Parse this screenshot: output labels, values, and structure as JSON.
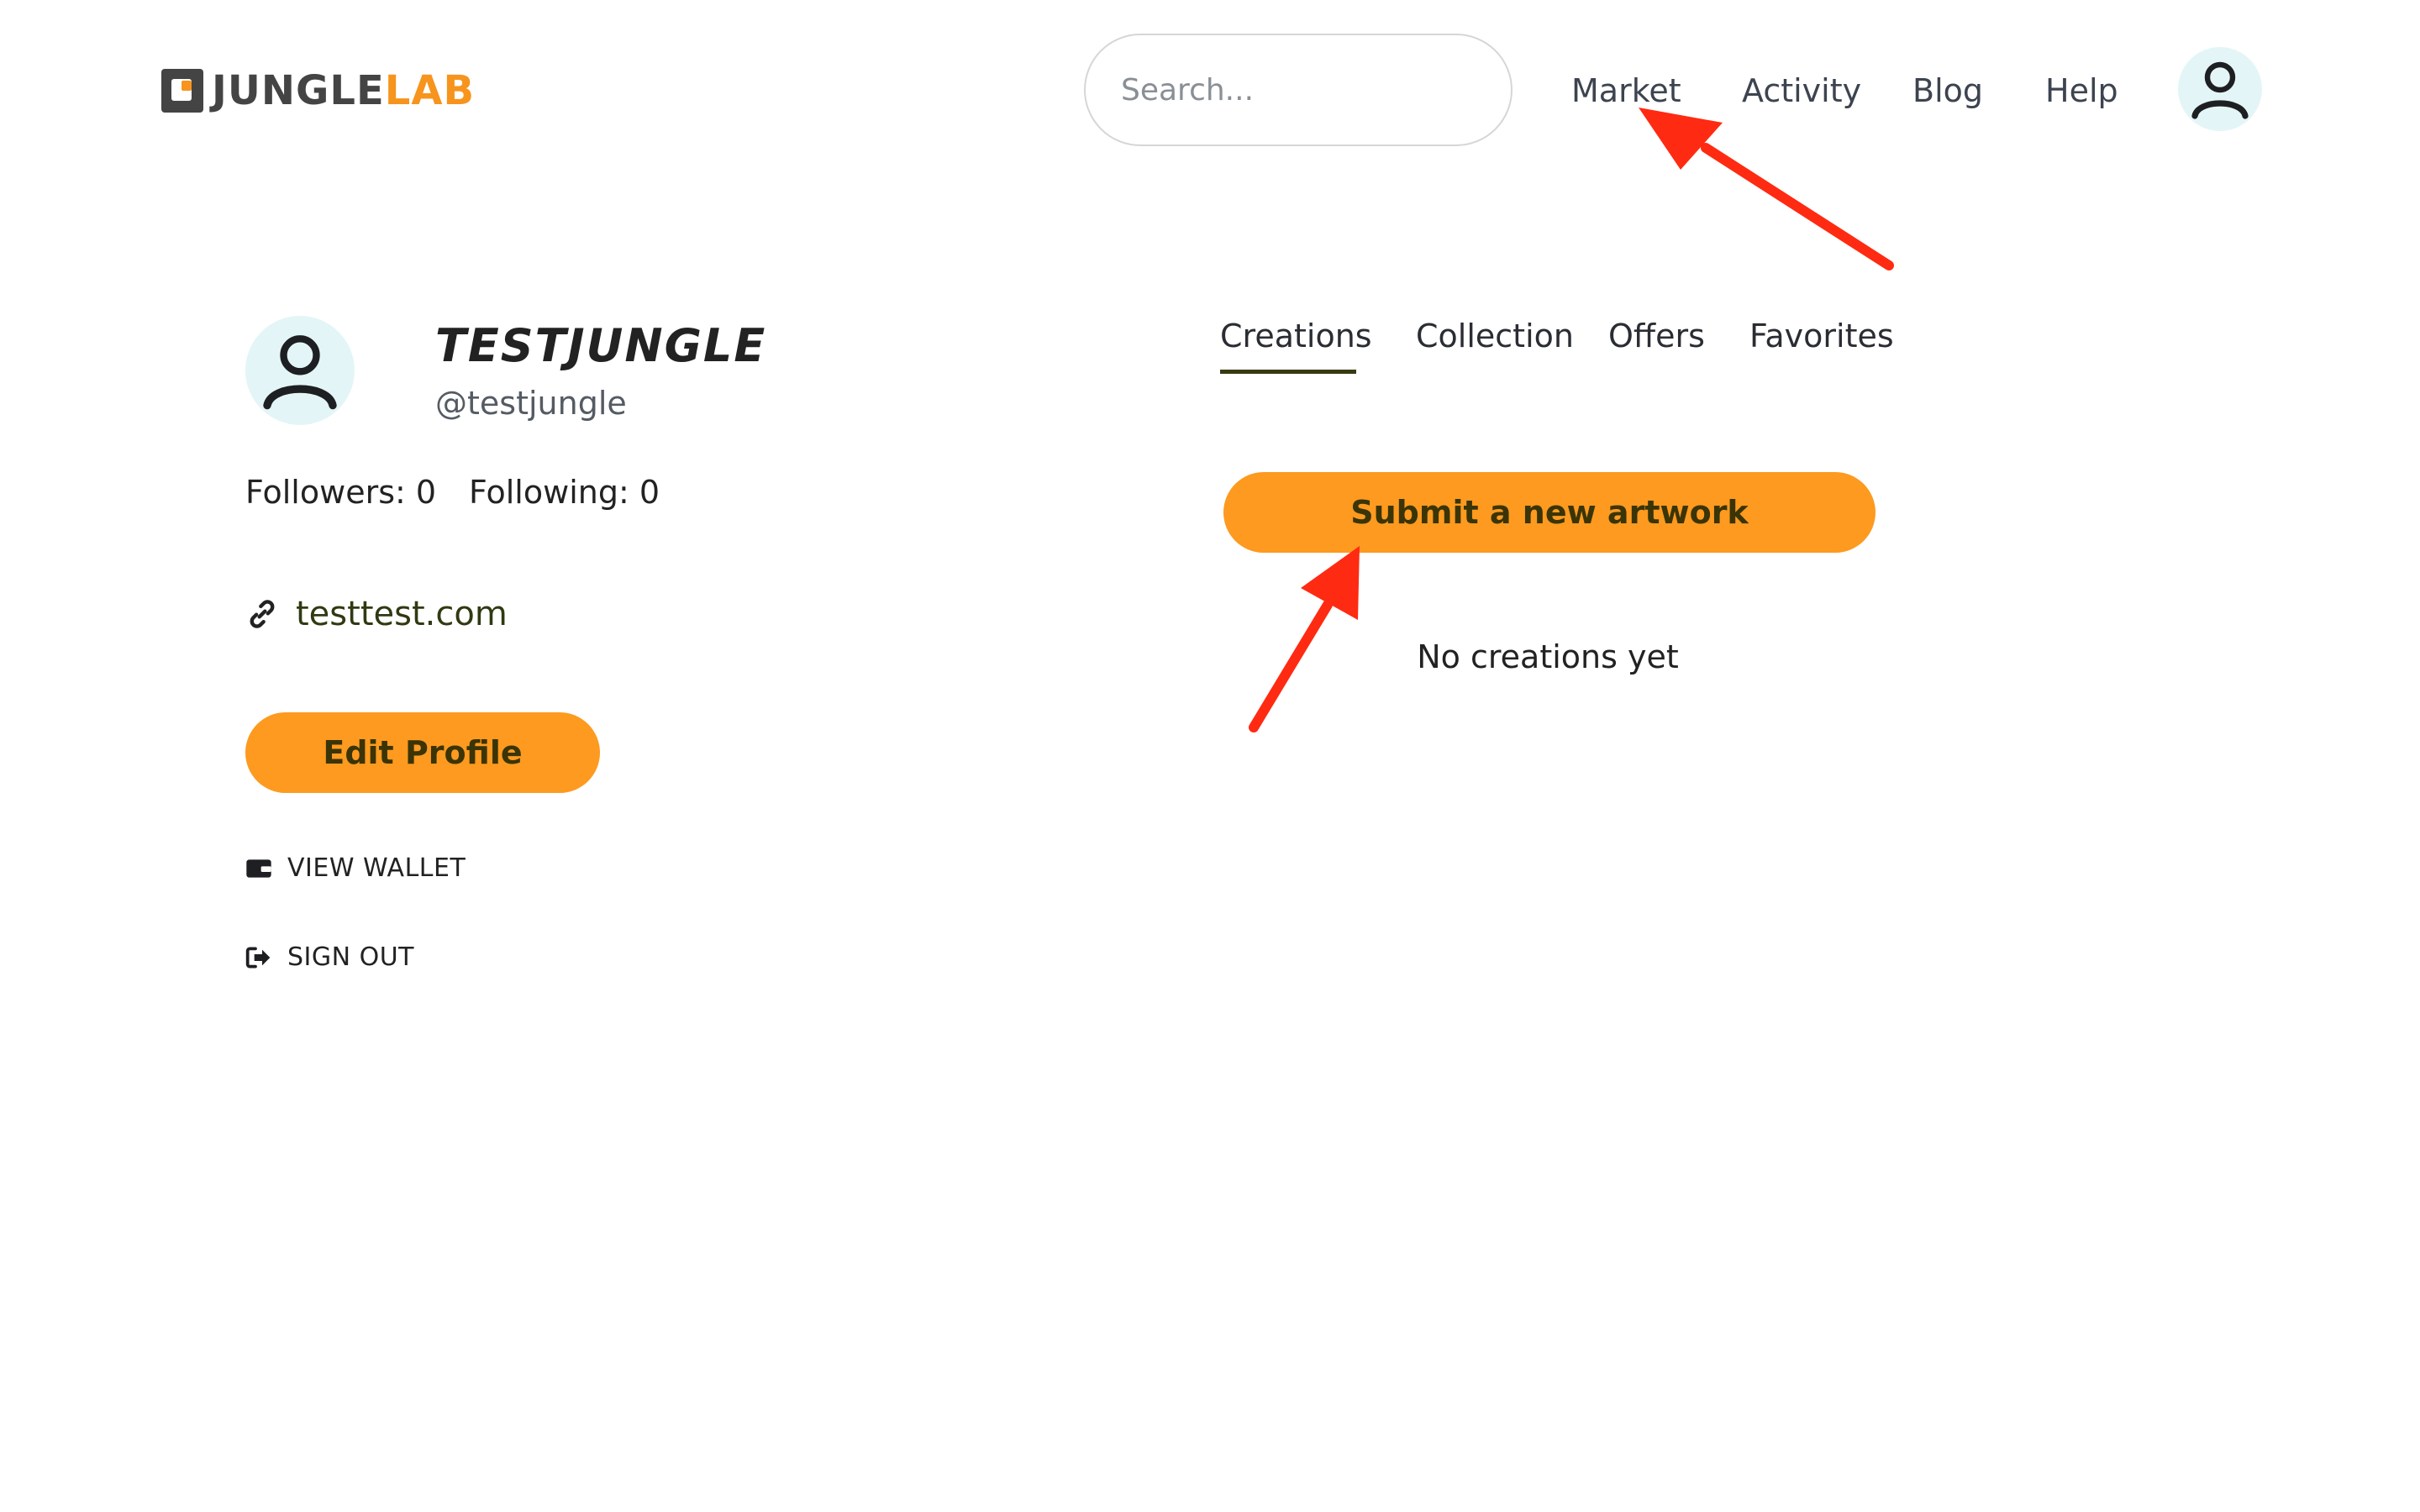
{
  "brand": {
    "part1": "JUNGLE",
    "part2": "LAB",
    "accent": "#f7941d"
  },
  "search": {
    "placeholder": "Search..."
  },
  "nav": {
    "market": "Market",
    "activity": "Activity",
    "blog": "Blog",
    "help": "Help"
  },
  "profile": {
    "display_name": "TESTJUNGLE",
    "handle": "@testjungle",
    "followers_label": "Followers: 0",
    "following_label": "Following: 0",
    "website": "testtest.com",
    "edit_button": "Edit Profile",
    "view_wallet": "VIEW WALLET",
    "sign_out": "SIGN OUT"
  },
  "tabs": {
    "creations": "Creations",
    "collection": "Collection",
    "offers": "Offers",
    "favorites": "Favorites"
  },
  "main": {
    "submit_button": "Submit a new artwork",
    "empty_state": "No creations yet"
  },
  "colors": {
    "button": "#fd9a1f",
    "arrow": "#ff2a12",
    "avatar_bg": "#e3f5f7"
  },
  "icons": {
    "search": "search-icon",
    "avatar": "user-icon",
    "link": "link-icon",
    "wallet": "wallet-icon",
    "sign_out": "sign-out-icon"
  }
}
